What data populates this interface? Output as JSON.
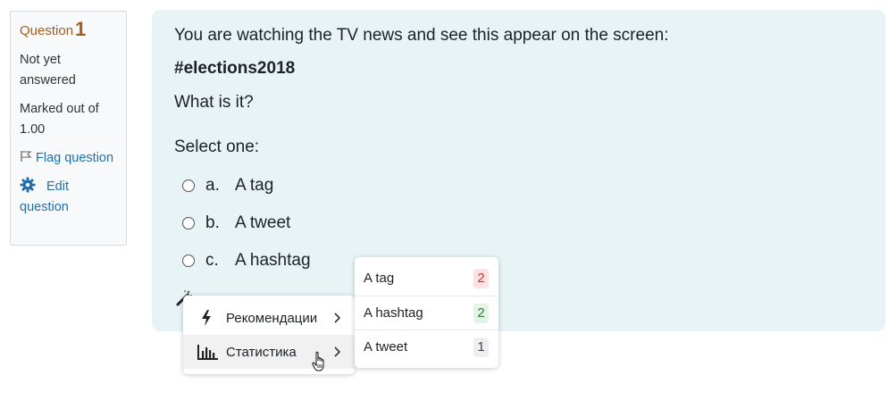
{
  "info": {
    "question_label": "Question",
    "question_number": "1",
    "state": "Not yet answered",
    "marks": "Marked out of 1.00",
    "flag": "Flag question",
    "edit": "Edit question"
  },
  "question": {
    "intro": "You are watching the TV news and see this appear on the screen:",
    "hashtag": "#elections2018",
    "ask": "What is it?",
    "prompt": "Select one:",
    "answers": [
      {
        "letter": "a.",
        "text": "A tag",
        "selected": false
      },
      {
        "letter": "b.",
        "text": "A tweet",
        "selected": false
      },
      {
        "letter": "c.",
        "text": "A hashtag",
        "selected": false
      }
    ]
  },
  "menu": {
    "items": [
      {
        "label": "Рекомендации",
        "icon": "bolt-icon"
      },
      {
        "label": "Статистика",
        "icon": "bar-chart-icon",
        "active": true
      }
    ]
  },
  "statistics": {
    "rows": [
      {
        "label": "A tag",
        "count": "2",
        "bg": "#fde2e4",
        "fg": "#c0392b"
      },
      {
        "label": "A hashtag",
        "count": "2",
        "bg": "#e3f3e5",
        "fg": "#2e7d32"
      },
      {
        "label": "A tweet",
        "count": "1",
        "bg": "#eceef1",
        "fg": "#444444"
      }
    ]
  },
  "colors": {
    "question_bg": "#e7f3f5",
    "info_bg": "#f8f9fa",
    "link": "#1f6fab",
    "question_number": "#a35e1d"
  }
}
